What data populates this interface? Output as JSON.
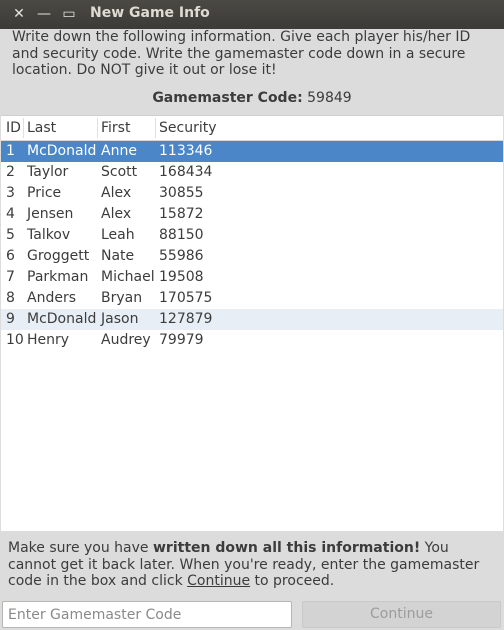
{
  "window": {
    "title": "New Game Info",
    "close_glyph": "✕",
    "min_glyph": "—",
    "max_glyph": "▭"
  },
  "intro": {
    "text": "Write down the following information. Give each player his/her ID and security code. Write the gamemaster code down in a secure location. Do NOT give it out or lose it!"
  },
  "gamemaster": {
    "label": "Gamemaster Code:",
    "code": "59849"
  },
  "table": {
    "headers": {
      "id": "ID",
      "last": "Last",
      "first": "First",
      "security": "Security"
    },
    "rows": [
      {
        "id": "1",
        "last": "McDonald",
        "first": "Anne",
        "security": "113346"
      },
      {
        "id": "2",
        "last": "Taylor",
        "first": "Scott",
        "security": "168434"
      },
      {
        "id": "3",
        "last": "Price",
        "first": "Alex",
        "security": "30855"
      },
      {
        "id": "4",
        "last": "Jensen",
        "first": "Alex",
        "security": "15872"
      },
      {
        "id": "5",
        "last": "Talkov",
        "first": "Leah",
        "security": "88150"
      },
      {
        "id": "6",
        "last": "Groggett",
        "first": "Nate",
        "security": "55986"
      },
      {
        "id": "7",
        "last": "Parkman",
        "first": "Michael",
        "security": "19508"
      },
      {
        "id": "8",
        "last": "Anders",
        "first": "Bryan",
        "security": "170575"
      },
      {
        "id": "9",
        "last": "McDonald",
        "first": "Jason",
        "security": "127879"
      },
      {
        "id": "10",
        "last": "Henry",
        "first": "Audrey",
        "security": "79979"
      }
    ]
  },
  "footer": {
    "msg_part1": "Make sure you have ",
    "msg_bold": "written down all this information!",
    "msg_part2": " You cannot get it back later. When you're ready, enter the gamemaster code in the box and click ",
    "msg_link": "Continue",
    "msg_part3": " to proceed."
  },
  "input": {
    "placeholder": "Enter Gamemaster Code",
    "value": ""
  },
  "continue_button": {
    "label": "Continue"
  },
  "colors": {
    "selection": "#4a86c8",
    "titlebar": "#3c3b37"
  }
}
